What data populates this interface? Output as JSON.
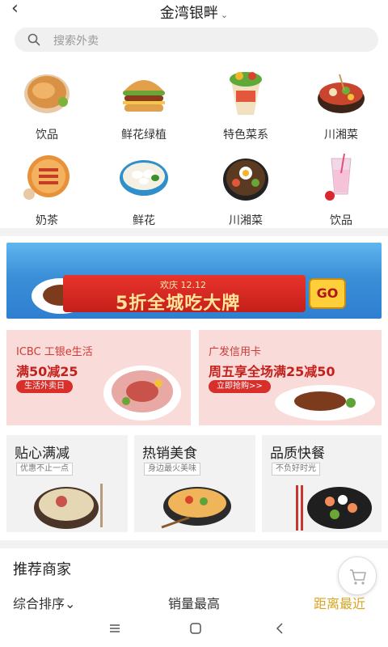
{
  "header": {
    "back_glyph": "‹",
    "location": "金湾银畔",
    "caret": "⌄"
  },
  "search": {
    "placeholder": "搜索外卖"
  },
  "categories": [
    {
      "label": "饮品",
      "icon": "flatbread-icon"
    },
    {
      "label": "鲜花绿植",
      "icon": "burger-icon"
    },
    {
      "label": "特色菜系",
      "icon": "wrap-icon"
    },
    {
      "label": "川湘菜",
      "icon": "hotpot-icon"
    },
    {
      "label": "奶茶",
      "icon": "pizza-icon"
    },
    {
      "label": "鲜花",
      "icon": "dumpling-bowl-icon"
    },
    {
      "label": "川湘菜",
      "icon": "bibimbap-icon"
    },
    {
      "label": "饮品",
      "icon": "smoothie-icon"
    }
  ],
  "banner": {
    "date": "欢庆 12.12",
    "slogan": "5折全城吃大牌",
    "go": "GO"
  },
  "promos": [
    {
      "line1": "ICBC 工银e生活",
      "line2": "满50减25",
      "tag": "生活外卖日"
    },
    {
      "line1": "广发信用卡",
      "line2": "周五享全场满25减50",
      "tag": "立即抢购>>"
    }
  ],
  "features": [
    {
      "title": "贴心满减",
      "sub": "优惠不止一点"
    },
    {
      "title": "热销美食",
      "sub": "身边最火美味"
    },
    {
      "title": "品质快餐",
      "sub": "不负好时光"
    }
  ],
  "recommend": {
    "title": "推荐商家",
    "sort_default": "综合排序⌄",
    "sort_sales": "销量最高",
    "sort_distance": "距离最近"
  },
  "colors": {
    "accent_gold": "#d9a51f",
    "promo_red": "#c4201c"
  }
}
